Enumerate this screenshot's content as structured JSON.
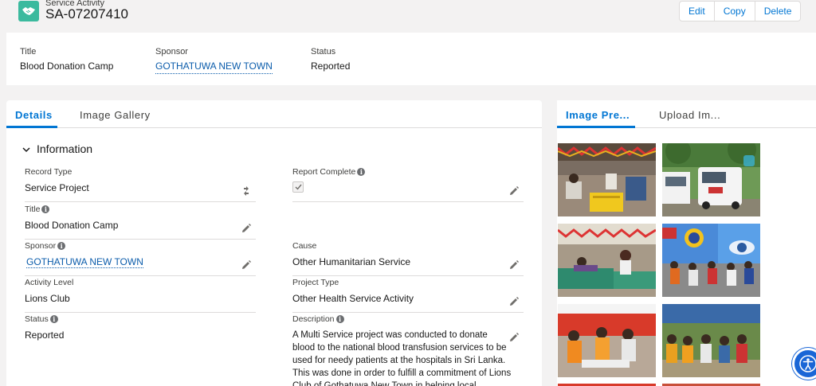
{
  "header": {
    "object_type": "Service Activity",
    "record_name": "SA-07207410",
    "icon": "handshake-icon",
    "icon_color": "#3bba9e",
    "actions": [
      "Edit",
      "Copy",
      "Delete"
    ]
  },
  "highlights": {
    "title_label": "Title",
    "title_value": "Blood Donation Camp",
    "sponsor_label": "Sponsor",
    "sponsor_value": "GOTHATUWA NEW TOWN",
    "status_label": "Status",
    "status_value": "Reported"
  },
  "left_tabs": [
    "Details",
    "Image Gallery"
  ],
  "section": {
    "title": "Information"
  },
  "fields": {
    "record_type": {
      "label": "Record Type",
      "value": "Service Project"
    },
    "report_complete": {
      "label": "Report Complete",
      "checked": true
    },
    "title": {
      "label": "Title",
      "value": "Blood Donation Camp"
    },
    "sponsor": {
      "label": "Sponsor",
      "value": "GOTHATUWA NEW TOWN"
    },
    "cause": {
      "label": "Cause",
      "value": "Other Humanitarian Service"
    },
    "activity_level": {
      "label": "Activity Level",
      "value": "Lions Club"
    },
    "project_type": {
      "label": "Project Type",
      "value": "Other Health Service Activity"
    },
    "status": {
      "label": "Status",
      "value": "Reported"
    },
    "description": {
      "label": "Description",
      "lines": [
        "A Multi Service project was conducted to donate",
        "blood to the national blood transfusion services to be",
        "used for needy patients at the hospitals in Sri Lanka.",
        "This was done in order to fulfill a commitment of Lions",
        "Club of Gothatuwa New Town in helping local"
      ]
    }
  },
  "right_tabs": [
    "Image Pre...",
    "Upload Im..."
  ],
  "colors": {
    "brand": "#0176d3",
    "link": "#0b5cab",
    "background": "#f3f2f2"
  }
}
